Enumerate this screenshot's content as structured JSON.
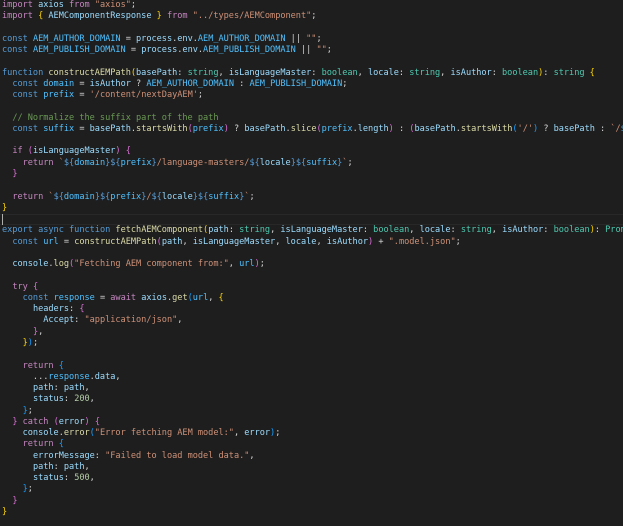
{
  "editor": {
    "theme_colors": {
      "background": "#1e1e1e",
      "keyword": "#c586c0",
      "storage": "#569cd6",
      "function": "#dcdcaa",
      "variable": "#9cdcfe",
      "constant": "#4fc1ff",
      "string": "#ce9178",
      "type": "#4ec9b0",
      "number": "#b5cea8",
      "comment": "#6a9955",
      "plain": "#d4d4d4"
    },
    "cursor_line": 19,
    "lines": [
      [
        [
          "kw",
          "import"
        ],
        [
          "pl",
          " "
        ],
        [
          "var",
          "axios"
        ],
        [
          "pl",
          " "
        ],
        [
          "kw",
          "from"
        ],
        [
          "pl",
          " "
        ],
        [
          "str",
          "\"axios\""
        ],
        [
          "pl",
          ";"
        ]
      ],
      [
        [
          "kw",
          "import"
        ],
        [
          "pl",
          " "
        ],
        [
          "br1",
          "{"
        ],
        [
          "pl",
          " "
        ],
        [
          "var",
          "AEMComponentResponse"
        ],
        [
          "pl",
          " "
        ],
        [
          "br1",
          "}"
        ],
        [
          "pl",
          " "
        ],
        [
          "kw",
          "from"
        ],
        [
          "pl",
          " "
        ],
        [
          "str",
          "\"../types/AEMComponent\""
        ],
        [
          "pl",
          ";"
        ]
      ],
      [],
      [
        [
          "st",
          "const"
        ],
        [
          "pl",
          " "
        ],
        [
          "cst",
          "AEM_AUTHOR_DOMAIN"
        ],
        [
          "pl",
          " = "
        ],
        [
          "var",
          "process"
        ],
        [
          "pl",
          "."
        ],
        [
          "var",
          "env"
        ],
        [
          "pl",
          "."
        ],
        [
          "cst",
          "AEM_AUTHOR_DOMAIN"
        ],
        [
          "pl",
          " || "
        ],
        [
          "str",
          "\"\""
        ],
        [
          "pl",
          ";"
        ]
      ],
      [
        [
          "st",
          "const"
        ],
        [
          "pl",
          " "
        ],
        [
          "cst",
          "AEM_PUBLISH_DOMAIN"
        ],
        [
          "pl",
          " = "
        ],
        [
          "var",
          "process"
        ],
        [
          "pl",
          "."
        ],
        [
          "var",
          "env"
        ],
        [
          "pl",
          "."
        ],
        [
          "cst",
          "AEM_PUBLISH_DOMAIN"
        ],
        [
          "pl",
          " || "
        ],
        [
          "str",
          "\"\""
        ],
        [
          "pl",
          ";"
        ]
      ],
      [],
      [
        [
          "st",
          "function"
        ],
        [
          "pl",
          " "
        ],
        [
          "fn",
          "constructAEMPath"
        ],
        [
          "br1",
          "("
        ],
        [
          "var",
          "basePath"
        ],
        [
          "pl",
          ": "
        ],
        [
          "ty",
          "string"
        ],
        [
          "pl",
          ", "
        ],
        [
          "var",
          "isLanguageMaster"
        ],
        [
          "pl",
          ": "
        ],
        [
          "ty",
          "boolean"
        ],
        [
          "pl",
          ", "
        ],
        [
          "var",
          "locale"
        ],
        [
          "pl",
          ": "
        ],
        [
          "ty",
          "string"
        ],
        [
          "pl",
          ", "
        ],
        [
          "var",
          "isAuthor"
        ],
        [
          "pl",
          ": "
        ],
        [
          "ty",
          "boolean"
        ],
        [
          "br1",
          ")"
        ],
        [
          "pl",
          ": "
        ],
        [
          "ty",
          "string"
        ],
        [
          "pl",
          " "
        ],
        [
          "br1",
          "{"
        ]
      ],
      [
        [
          "pl",
          "  "
        ],
        [
          "st",
          "const"
        ],
        [
          "pl",
          " "
        ],
        [
          "cst",
          "domain"
        ],
        [
          "pl",
          " = "
        ],
        [
          "var",
          "isAuthor"
        ],
        [
          "pl",
          " ? "
        ],
        [
          "cst",
          "AEM_AUTHOR_DOMAIN"
        ],
        [
          "pl",
          " : "
        ],
        [
          "cst",
          "AEM_PUBLISH_DOMAIN"
        ],
        [
          "pl",
          ";"
        ]
      ],
      [
        [
          "pl",
          "  "
        ],
        [
          "st",
          "const"
        ],
        [
          "pl",
          " "
        ],
        [
          "cst",
          "prefix"
        ],
        [
          "pl",
          " = "
        ],
        [
          "str",
          "'/content/nextDayAEM'"
        ],
        [
          "pl",
          ";"
        ]
      ],
      [],
      [
        [
          "pl",
          "  "
        ],
        [
          "com",
          "// Normalize the suffix part of the path"
        ]
      ],
      [
        [
          "pl",
          "  "
        ],
        [
          "st",
          "const"
        ],
        [
          "pl",
          " "
        ],
        [
          "cst",
          "suffix"
        ],
        [
          "pl",
          " = "
        ],
        [
          "var",
          "basePath"
        ],
        [
          "pl",
          "."
        ],
        [
          "fn",
          "startsWith"
        ],
        [
          "br2",
          "("
        ],
        [
          "cst",
          "prefix"
        ],
        [
          "br2",
          ")"
        ],
        [
          "pl",
          " ? "
        ],
        [
          "var",
          "basePath"
        ],
        [
          "pl",
          "."
        ],
        [
          "fn",
          "slice"
        ],
        [
          "br2",
          "("
        ],
        [
          "cst",
          "prefix"
        ],
        [
          "pl",
          "."
        ],
        [
          "var",
          "length"
        ],
        [
          "br2",
          ")"
        ],
        [
          "pl",
          " : "
        ],
        [
          "br2",
          "("
        ],
        [
          "var",
          "basePath"
        ],
        [
          "pl",
          "."
        ],
        [
          "fn",
          "startsWith"
        ],
        [
          "br3",
          "("
        ],
        [
          "str",
          "'/'"
        ],
        [
          "br3",
          ")"
        ],
        [
          "pl",
          " ? "
        ],
        [
          "var",
          "basePath"
        ],
        [
          "pl",
          " : "
        ],
        [
          "str",
          "`/"
        ],
        [
          "st",
          "${"
        ],
        [
          "var",
          "basePath"
        ],
        [
          "st",
          "}"
        ],
        [
          "str",
          "`"
        ],
        [
          "br2",
          ")"
        ],
        [
          "pl",
          ";"
        ]
      ],
      [],
      [
        [
          "pl",
          "  "
        ],
        [
          "kw",
          "if"
        ],
        [
          "pl",
          " "
        ],
        [
          "br2",
          "("
        ],
        [
          "var",
          "isLanguageMaster"
        ],
        [
          "br2",
          ")"
        ],
        [
          "pl",
          " "
        ],
        [
          "br2",
          "{"
        ]
      ],
      [
        [
          "pl",
          "    "
        ],
        [
          "kw",
          "return"
        ],
        [
          "pl",
          " "
        ],
        [
          "str",
          "`"
        ],
        [
          "st",
          "${"
        ],
        [
          "cst",
          "domain"
        ],
        [
          "st",
          "}${"
        ],
        [
          "cst",
          "prefix"
        ],
        [
          "st",
          "}"
        ],
        [
          "str",
          "/language-masters/"
        ],
        [
          "st",
          "${"
        ],
        [
          "var",
          "locale"
        ],
        [
          "st",
          "}${"
        ],
        [
          "cst",
          "suffix"
        ],
        [
          "st",
          "}"
        ],
        [
          "str",
          "`"
        ],
        [
          "pl",
          ";"
        ]
      ],
      [
        [
          "pl",
          "  "
        ],
        [
          "br2",
          "}"
        ]
      ],
      [],
      [
        [
          "pl",
          "  "
        ],
        [
          "kw",
          "return"
        ],
        [
          "pl",
          " "
        ],
        [
          "str",
          "`"
        ],
        [
          "st",
          "${"
        ],
        [
          "cst",
          "domain"
        ],
        [
          "st",
          "}${"
        ],
        [
          "cst",
          "prefix"
        ],
        [
          "st",
          "}"
        ],
        [
          "str",
          "/"
        ],
        [
          "st",
          "${"
        ],
        [
          "var",
          "locale"
        ],
        [
          "st",
          "}${"
        ],
        [
          "cst",
          "suffix"
        ],
        [
          "st",
          "}"
        ],
        [
          "str",
          "`"
        ],
        [
          "pl",
          ";"
        ]
      ],
      [
        [
          "br1",
          "}"
        ]
      ],
      [],
      [
        [
          "st",
          "export"
        ],
        [
          "pl",
          " "
        ],
        [
          "st",
          "async"
        ],
        [
          "pl",
          " "
        ],
        [
          "st",
          "function"
        ],
        [
          "pl",
          " "
        ],
        [
          "fn",
          "fetchAEMComponent"
        ],
        [
          "br1",
          "("
        ],
        [
          "var",
          "path"
        ],
        [
          "pl",
          ": "
        ],
        [
          "ty",
          "string"
        ],
        [
          "pl",
          ", "
        ],
        [
          "var",
          "isLanguageMaster"
        ],
        [
          "pl",
          ": "
        ],
        [
          "ty",
          "boolean"
        ],
        [
          "pl",
          ", "
        ],
        [
          "var",
          "locale"
        ],
        [
          "pl",
          ": "
        ],
        [
          "ty",
          "string"
        ],
        [
          "pl",
          ", "
        ],
        [
          "var",
          "isAuthor"
        ],
        [
          "pl",
          ": "
        ],
        [
          "ty",
          "boolean"
        ],
        [
          "br1",
          ")"
        ],
        [
          "pl",
          ": "
        ],
        [
          "ty",
          "Promise"
        ],
        [
          "pl",
          "<"
        ],
        [
          "ty",
          "AEMComponent"
        ]
      ],
      [
        [
          "pl",
          "  "
        ],
        [
          "st",
          "const"
        ],
        [
          "pl",
          " "
        ],
        [
          "cst",
          "url"
        ],
        [
          "pl",
          " = "
        ],
        [
          "fn",
          "constructAEMPath"
        ],
        [
          "br2",
          "("
        ],
        [
          "var",
          "path"
        ],
        [
          "pl",
          ", "
        ],
        [
          "var",
          "isLanguageMaster"
        ],
        [
          "pl",
          ", "
        ],
        [
          "var",
          "locale"
        ],
        [
          "pl",
          ", "
        ],
        [
          "var",
          "isAuthor"
        ],
        [
          "br2",
          ")"
        ],
        [
          "pl",
          " + "
        ],
        [
          "str",
          "\".model.json\""
        ],
        [
          "pl",
          ";"
        ]
      ],
      [],
      [
        [
          "pl",
          "  "
        ],
        [
          "var",
          "console"
        ],
        [
          "pl",
          "."
        ],
        [
          "fn",
          "log"
        ],
        [
          "br2",
          "("
        ],
        [
          "str",
          "\"Fetching AEM component from:\""
        ],
        [
          "pl",
          ", "
        ],
        [
          "cst",
          "url"
        ],
        [
          "br2",
          ")"
        ],
        [
          "pl",
          ";"
        ]
      ],
      [],
      [
        [
          "pl",
          "  "
        ],
        [
          "kw",
          "try"
        ],
        [
          "pl",
          " "
        ],
        [
          "br2",
          "{"
        ]
      ],
      [
        [
          "pl",
          "    "
        ],
        [
          "st",
          "const"
        ],
        [
          "pl",
          " "
        ],
        [
          "cst",
          "response"
        ],
        [
          "pl",
          " = "
        ],
        [
          "kw",
          "await"
        ],
        [
          "pl",
          " "
        ],
        [
          "var",
          "axios"
        ],
        [
          "pl",
          "."
        ],
        [
          "fn",
          "get"
        ],
        [
          "br3",
          "("
        ],
        [
          "cst",
          "url"
        ],
        [
          "pl",
          ", "
        ],
        [
          "br1",
          "{"
        ]
      ],
      [
        [
          "pl",
          "      "
        ],
        [
          "var",
          "headers"
        ],
        [
          "pl",
          ": "
        ],
        [
          "br2",
          "{"
        ]
      ],
      [
        [
          "pl",
          "        "
        ],
        [
          "var",
          "Accept"
        ],
        [
          "pl",
          ": "
        ],
        [
          "str",
          "\"application/json\""
        ],
        [
          "pl",
          ","
        ]
      ],
      [
        [
          "pl",
          "      "
        ],
        [
          "br2",
          "}"
        ],
        [
          "pl",
          ","
        ]
      ],
      [
        [
          "pl",
          "    "
        ],
        [
          "br1",
          "}"
        ],
        [
          "br3",
          ")"
        ],
        [
          "pl",
          ";"
        ]
      ],
      [],
      [
        [
          "pl",
          "    "
        ],
        [
          "kw",
          "return"
        ],
        [
          "pl",
          " "
        ],
        [
          "br3",
          "{"
        ]
      ],
      [
        [
          "pl",
          "      ..."
        ],
        [
          "cst",
          "response"
        ],
        [
          "pl",
          "."
        ],
        [
          "var",
          "data"
        ],
        [
          "pl",
          ","
        ]
      ],
      [
        [
          "pl",
          "      "
        ],
        [
          "var",
          "path"
        ],
        [
          "pl",
          ": "
        ],
        [
          "var",
          "path"
        ],
        [
          "pl",
          ","
        ]
      ],
      [
        [
          "pl",
          "      "
        ],
        [
          "var",
          "status"
        ],
        [
          "pl",
          ": "
        ],
        [
          "num",
          "200"
        ],
        [
          "pl",
          ","
        ]
      ],
      [
        [
          "pl",
          "    "
        ],
        [
          "br3",
          "}"
        ],
        [
          "pl",
          ";"
        ]
      ],
      [
        [
          "pl",
          "  "
        ],
        [
          "br2",
          "}"
        ],
        [
          "pl",
          " "
        ],
        [
          "kw",
          "catch"
        ],
        [
          "pl",
          " "
        ],
        [
          "br2",
          "("
        ],
        [
          "var",
          "error"
        ],
        [
          "br2",
          ")"
        ],
        [
          "pl",
          " "
        ],
        [
          "br2",
          "{"
        ]
      ],
      [
        [
          "pl",
          "    "
        ],
        [
          "var",
          "console"
        ],
        [
          "pl",
          "."
        ],
        [
          "fn",
          "error"
        ],
        [
          "br3",
          "("
        ],
        [
          "str",
          "\"Error fetching AEM model:\""
        ],
        [
          "pl",
          ", "
        ],
        [
          "var",
          "error"
        ],
        [
          "br3",
          ")"
        ],
        [
          "pl",
          ";"
        ]
      ],
      [
        [
          "pl",
          "    "
        ],
        [
          "kw",
          "return"
        ],
        [
          "pl",
          " "
        ],
        [
          "br3",
          "{"
        ]
      ],
      [
        [
          "pl",
          "      "
        ],
        [
          "var",
          "errorMessage"
        ],
        [
          "pl",
          ": "
        ],
        [
          "str",
          "\"Failed to load model data.\""
        ],
        [
          "pl",
          ","
        ]
      ],
      [
        [
          "pl",
          "      "
        ],
        [
          "var",
          "path"
        ],
        [
          "pl",
          ": "
        ],
        [
          "var",
          "path"
        ],
        [
          "pl",
          ","
        ]
      ],
      [
        [
          "pl",
          "      "
        ],
        [
          "var",
          "status"
        ],
        [
          "pl",
          ": "
        ],
        [
          "num",
          "500"
        ],
        [
          "pl",
          ","
        ]
      ],
      [
        [
          "pl",
          "    "
        ],
        [
          "br3",
          "}"
        ],
        [
          "pl",
          ";"
        ]
      ],
      [
        [
          "pl",
          "  "
        ],
        [
          "br2",
          "}"
        ]
      ],
      [
        [
          "br1",
          "}"
        ]
      ]
    ]
  }
}
